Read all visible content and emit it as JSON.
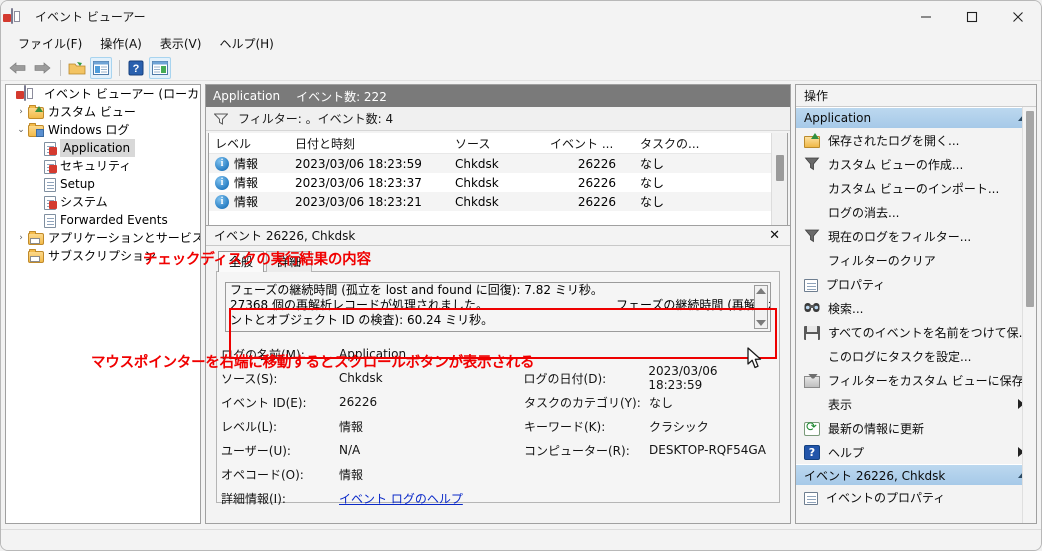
{
  "window": {
    "title": "イベント ビューアー",
    "icon": "event-viewer-icon",
    "minimize": "−",
    "maximize": "□",
    "close": "✕"
  },
  "menubar": {
    "items": [
      {
        "label": "ファイル(F)",
        "accel": "F"
      },
      {
        "label": "操作(A)",
        "accel": "A"
      },
      {
        "label": "表示(V)",
        "accel": "V"
      },
      {
        "label": "ヘルプ(H)",
        "accel": "H"
      }
    ]
  },
  "toolbar": {
    "buttons": [
      {
        "name": "back-icon",
        "label": "戻る"
      },
      {
        "name": "forward-icon",
        "label": "進む"
      },
      {
        "name": "open-folder-icon",
        "label": "保存されたログを開く"
      },
      {
        "name": "show-hide-tree-icon",
        "label": "ツリーの表示/非表示"
      },
      {
        "name": "help-icon",
        "label": "ヘルプ"
      },
      {
        "name": "show-hide-actions-icon",
        "label": "操作ウィンドウの表示/非表示"
      }
    ]
  },
  "tree": {
    "root": {
      "label": "イベント ビューアー (ローカル)",
      "icon": "event-viewer-icon"
    },
    "items": [
      {
        "label": "カスタム ビュー",
        "icon": "folder-custom-icon",
        "chevron": "›",
        "indent": 1,
        "selected": false
      },
      {
        "label": "Windows ログ",
        "icon": "folder-windows-icon",
        "chevron": "⌄",
        "indent": 1,
        "selected": false
      },
      {
        "label": "Application",
        "icon": "log-warn-icon",
        "chevron": "",
        "indent": 2,
        "selected": true
      },
      {
        "label": "セキュリティ",
        "icon": "log-warn-icon",
        "chevron": "",
        "indent": 2,
        "selected": false
      },
      {
        "label": "Setup",
        "icon": "log-icon",
        "chevron": "",
        "indent": 2,
        "selected": false
      },
      {
        "label": "システム",
        "icon": "log-warn-icon",
        "chevron": "",
        "indent": 2,
        "selected": false
      },
      {
        "label": "Forwarded Events",
        "icon": "log-icon",
        "chevron": "",
        "indent": 2,
        "selected": false
      },
      {
        "label": "アプリケーションとサービス ログ",
        "icon": "folder-icon",
        "chevron": "›",
        "indent": 1,
        "selected": false
      },
      {
        "label": "サブスクリプション",
        "icon": "folder-subscription-icon",
        "chevron": "",
        "indent": 1,
        "selected": false
      }
    ]
  },
  "center": {
    "header": {
      "title": "Application",
      "count_label": "イベント数: 222"
    },
    "filter": {
      "icon": "funnel-icon",
      "text": "フィルター: 。イベント数: 4"
    },
    "list": {
      "columns": [
        "レベル",
        "日付と時刻",
        "ソース",
        "イベント ...",
        "タスクの..."
      ],
      "rows": [
        {
          "icon": "information-icon",
          "level": "情報",
          "datetime": "2023/03/06 18:23:59",
          "source": "Chkdsk",
          "event_id": "26226",
          "task": "なし"
        },
        {
          "icon": "information-icon",
          "level": "情報",
          "datetime": "2023/03/06 18:23:37",
          "source": "Chkdsk",
          "event_id": "26226",
          "task": "なし"
        },
        {
          "icon": "information-icon",
          "level": "情報",
          "datetime": "2023/03/06 18:23:21",
          "source": "Chkdsk",
          "event_id": "26226",
          "task": "なし"
        }
      ]
    }
  },
  "detail": {
    "header": "イベント 26226, Chkdsk",
    "close": "✕",
    "tabs": [
      {
        "label": "全般",
        "active": true
      },
      {
        "label": "詳細",
        "active": false
      }
    ],
    "description_lines": [
      {
        "text": "フェーズの継続時間 (孤立を lost and found に回復): 7.82 ミリ秒。",
        "far": ""
      },
      {
        "text": " 27368 個の再解析レコードが処理されました。",
        "far": "フェーズの継続時間 (再解析ポイ"
      },
      {
        "text": "ントとオブジェクト ID の検査): 60.24 ミリ秒。",
        "far": ""
      }
    ],
    "scroll_up": "▲",
    "scroll_down": "▼",
    "fields": [
      {
        "label": "ログの名前(M):",
        "value": "Application",
        "label2": "",
        "value2": ""
      },
      {
        "label": "ソース(S):",
        "value": "Chkdsk",
        "label2": "ログの日付(D):",
        "value2": "2023/03/06 18:23:59"
      },
      {
        "label": "イベント ID(E):",
        "value": "26226",
        "label2": "タスクのカテゴリ(Y):",
        "value2": "なし"
      },
      {
        "label": "レベル(L):",
        "value": "情報",
        "label2": "キーワード(K):",
        "value2": "クラシック"
      },
      {
        "label": "ユーザー(U):",
        "value": "N/A",
        "label2": "コンピューター(R):",
        "value2": "DESKTOP-RQF54GA"
      },
      {
        "label": "オペコード(O):",
        "value": "情報",
        "label2": "",
        "value2": ""
      },
      {
        "label": "詳細情報(I):",
        "value": "",
        "label2": "",
        "value2": "",
        "link": "イベント ログのヘルプ"
      }
    ]
  },
  "annotations": {
    "top": "チェックディスクの実行結果の内容",
    "bottom": "マウスポインターを右端に移動するとスクロールボタンが表示される",
    "color": "#f00000"
  },
  "actions": {
    "title": "操作",
    "groups": [
      {
        "label": "Application",
        "caret": "▲",
        "items": [
          {
            "label": "保存されたログを開く...",
            "icon": "open-saved-log-icon",
            "submenu": false
          },
          {
            "label": "カスタム ビューの作成...",
            "icon": "create-custom-view-icon",
            "submenu": false
          },
          {
            "label": "カスタム ビューのインポート...",
            "icon": "",
            "submenu": false
          },
          {
            "label": "ログの消去...",
            "icon": "",
            "submenu": false
          },
          {
            "label": "現在のログをフィルター...",
            "icon": "filter-current-log-icon",
            "submenu": false
          },
          {
            "label": "フィルターのクリア",
            "icon": "",
            "submenu": false
          },
          {
            "label": "プロパティ",
            "icon": "properties-icon",
            "submenu": false
          },
          {
            "label": "検索...",
            "icon": "find-icon",
            "submenu": false
          },
          {
            "label": "すべてのイベントを名前をつけて保...",
            "icon": "save-all-events-icon",
            "submenu": false
          },
          {
            "label": "このログにタスクを設定...",
            "icon": "",
            "submenu": false
          },
          {
            "label": "フィルターをカスタム ビューに保存...",
            "icon": "save-filter-icon",
            "submenu": false
          },
          {
            "label": "表示",
            "icon": "",
            "submenu": true
          },
          {
            "label": "最新の情報に更新",
            "icon": "refresh-icon",
            "submenu": false
          },
          {
            "label": "ヘルプ",
            "icon": "help-icon",
            "submenu": true
          }
        ]
      },
      {
        "label": "イベント 26226, Chkdsk",
        "caret": "▲",
        "items": [
          {
            "label": "イベントのプロパティ",
            "icon": "event-properties-icon",
            "submenu": false
          }
        ]
      }
    ]
  }
}
